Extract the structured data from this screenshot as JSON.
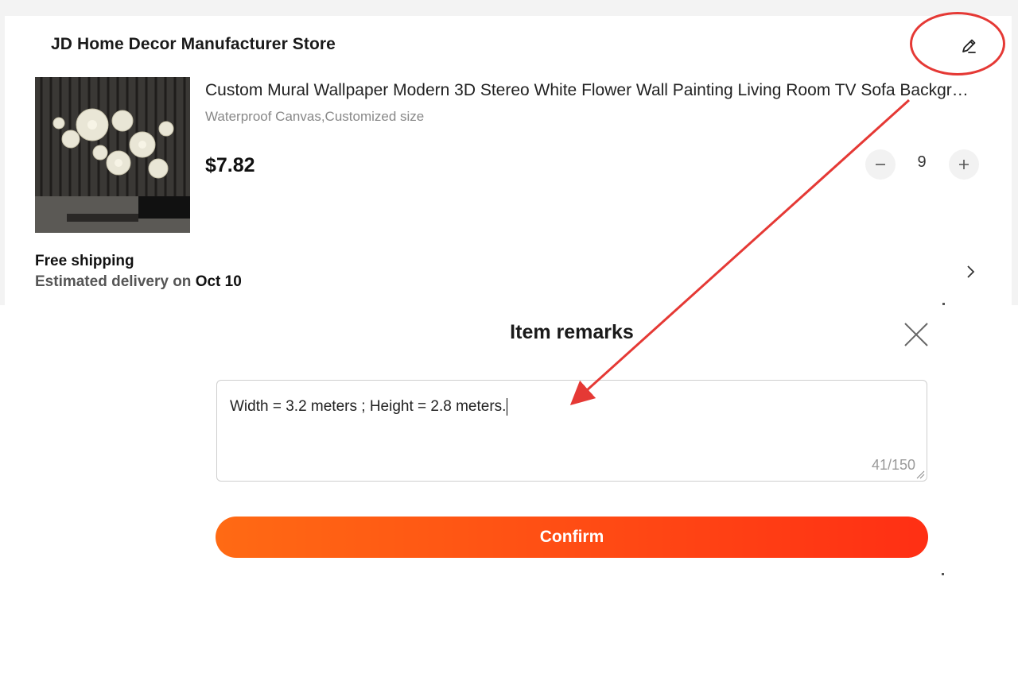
{
  "store": {
    "name": "JD Home Decor Manufacturer Store"
  },
  "product": {
    "title": "Custom Mural Wallpaper Modern 3D Stereo White Flower Wall Painting Living Room TV Sofa Background",
    "variant": "Waterproof Canvas,Customized size",
    "price": "$7.82",
    "quantity": "9"
  },
  "shipping": {
    "title": "Free shipping",
    "estimate_prefix": "Estimated delivery on ",
    "estimate_date": "Oct 10"
  },
  "remarks_modal": {
    "title": "Item remarks",
    "input_value": "Width = 3.2 meters ; Height = 2.8 meters.",
    "counter": "41/150",
    "confirm_label": "Confirm"
  },
  "icons": {
    "edit": "pencil-icon",
    "minus": "minus-icon",
    "plus": "plus-icon",
    "chevron": "chevron-right-icon",
    "close": "close-icon"
  },
  "colors": {
    "accent_start": "#ff6a14",
    "accent_end": "#ff2f14",
    "annotation": "#e53935"
  }
}
